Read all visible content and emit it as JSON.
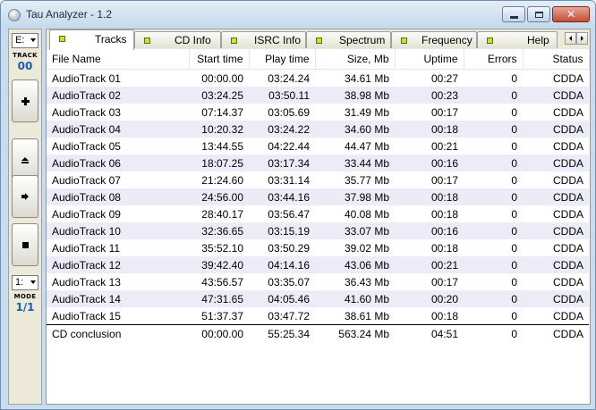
{
  "window": {
    "title": "Tau Analyzer - 1.2"
  },
  "sidebar": {
    "drive_value": "E:",
    "track_label": "TRACK",
    "track_value": "00",
    "speed_value": "1:",
    "mode_label": "MODE",
    "mode_value": "1/1"
  },
  "tabs": [
    {
      "label": "Tracks",
      "active": true
    },
    {
      "label": "CD Info"
    },
    {
      "label": "ISRC Info"
    },
    {
      "label": "Spectrum"
    },
    {
      "label": "Frequency"
    },
    {
      "label": "Help"
    }
  ],
  "table": {
    "columns": [
      "File Name",
      "Start time",
      "Play time",
      "Size, Mb",
      "Uptime",
      "Errors",
      "Status"
    ],
    "rows": [
      [
        "AudioTrack 01",
        "00:00.00",
        "03:24.24",
        "34.61 Mb",
        "00:27",
        "0",
        "CDDA"
      ],
      [
        "AudioTrack 02",
        "03:24.25",
        "03:50.11",
        "38.98 Mb",
        "00:23",
        "0",
        "CDDA"
      ],
      [
        "AudioTrack 03",
        "07:14.37",
        "03:05.69",
        "31.49 Mb",
        "00:17",
        "0",
        "CDDA"
      ],
      [
        "AudioTrack 04",
        "10:20.32",
        "03:24.22",
        "34.60 Mb",
        "00:18",
        "0",
        "CDDA"
      ],
      [
        "AudioTrack 05",
        "13:44.55",
        "04:22.44",
        "44.47 Mb",
        "00:21",
        "0",
        "CDDA"
      ],
      [
        "AudioTrack 06",
        "18:07.25",
        "03:17.34",
        "33.44 Mb",
        "00:16",
        "0",
        "CDDA"
      ],
      [
        "AudioTrack 07",
        "21:24.60",
        "03:31.14",
        "35.77 Mb",
        "00:17",
        "0",
        "CDDA"
      ],
      [
        "AudioTrack 08",
        "24:56.00",
        "03:44.16",
        "37.98 Mb",
        "00:18",
        "0",
        "CDDA"
      ],
      [
        "AudioTrack 09",
        "28:40.17",
        "03:56.47",
        "40.08 Mb",
        "00:18",
        "0",
        "CDDA"
      ],
      [
        "AudioTrack 10",
        "32:36.65",
        "03:15.19",
        "33.07 Mb",
        "00:16",
        "0",
        "CDDA"
      ],
      [
        "AudioTrack 11",
        "35:52.10",
        "03:50.29",
        "39.02 Mb",
        "00:18",
        "0",
        "CDDA"
      ],
      [
        "AudioTrack 12",
        "39:42.40",
        "04:14.16",
        "43.06 Mb",
        "00:21",
        "0",
        "CDDA"
      ],
      [
        "AudioTrack 13",
        "43:56.57",
        "03:35.07",
        "36.43 Mb",
        "00:17",
        "0",
        "CDDA"
      ],
      [
        "AudioTrack 14",
        "47:31.65",
        "04:05.46",
        "41.60 Mb",
        "00:20",
        "0",
        "CDDA"
      ],
      [
        "AudioTrack 15",
        "51:37.37",
        "03:47.72",
        "38.61 Mb",
        "00:18",
        "0",
        "CDDA"
      ]
    ],
    "summary": [
      "CD conclusion",
      "00:00.00",
      "55:25.34",
      "563.24 Mb",
      "04:51",
      "0",
      "CDDA"
    ]
  }
}
